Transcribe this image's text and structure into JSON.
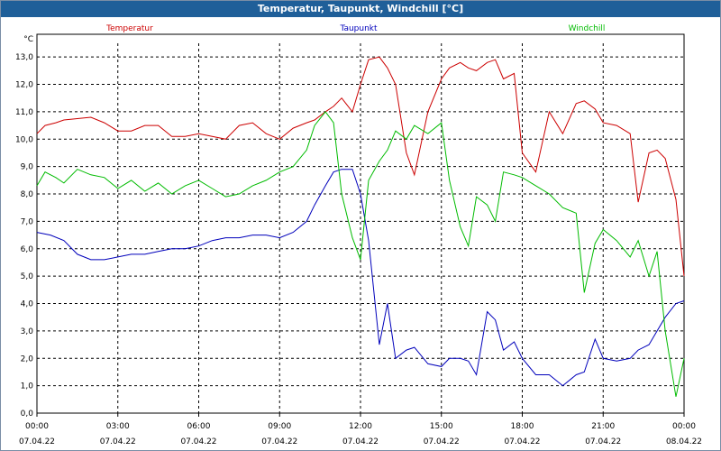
{
  "window": {
    "title": "Temperatur, Taupunkt, Windchill [°C]"
  },
  "colors": {
    "temperatur": "#cc0000",
    "taupunkt": "#0000bb",
    "windchill": "#00bb00",
    "titlebar": "#1f5f99",
    "grid": "#000000"
  },
  "chart_data": {
    "type": "line",
    "title": "Temperatur, Taupunkt, Windchill [°C]",
    "ylabel": "°C",
    "ylim": [
      0,
      13.5
    ],
    "yticks": [
      "0,0",
      "1,0",
      "2,0",
      "3,0",
      "4,0",
      "5,0",
      "6,0",
      "7,0",
      "8,0",
      "9,0",
      "10,0",
      "11,0",
      "12,0",
      "13,0"
    ],
    "xlim": [
      0,
      24
    ],
    "xticks": [
      {
        "time": "00:00",
        "date": "07.04.22"
      },
      {
        "time": "03:00",
        "date": "07.04.22"
      },
      {
        "time": "06:00",
        "date": "07.04.22"
      },
      {
        "time": "09:00",
        "date": "07.04.22"
      },
      {
        "time": "12:00",
        "date": "07.04.22"
      },
      {
        "time": "15:00",
        "date": "07.04.22"
      },
      {
        "time": "18:00",
        "date": "07.04.22"
      },
      {
        "time": "21:00",
        "date": "07.04.22"
      },
      {
        "time": "00:00",
        "date": "08.04.22"
      }
    ],
    "grid": true,
    "legend_position": "top",
    "series": [
      {
        "name": "Temperatur",
        "color": "#cc0000",
        "x": [
          0,
          0.3,
          0.7,
          1,
          1.5,
          2,
          2.5,
          3,
          3.5,
          4,
          4.5,
          5,
          5.5,
          6,
          6.5,
          7,
          7.5,
          8,
          8.5,
          9,
          9.5,
          10,
          10.3,
          10.7,
          11,
          11.3,
          11.7,
          12,
          12.3,
          12.7,
          13,
          13.3,
          13.7,
          14,
          14.5,
          15,
          15.3,
          15.7,
          16,
          16.3,
          16.7,
          17,
          17.3,
          17.7,
          18,
          18.5,
          19,
          19.5,
          20,
          20.3,
          20.7,
          21,
          21.5,
          22,
          22.3,
          22.7,
          23,
          23.3,
          23.7,
          24
        ],
        "y": [
          10.2,
          10.5,
          10.6,
          10.7,
          10.75,
          10.8,
          10.6,
          10.3,
          10.3,
          10.5,
          10.5,
          10.1,
          10.1,
          10.2,
          10.1,
          10.0,
          10.5,
          10.6,
          10.2,
          10.0,
          10.4,
          10.6,
          10.7,
          11.0,
          11.2,
          11.5,
          11.0,
          12.0,
          12.9,
          13.0,
          12.6,
          12.0,
          9.5,
          8.7,
          11.0,
          12.2,
          12.6,
          12.8,
          12.6,
          12.5,
          12.8,
          12.9,
          12.2,
          12.4,
          9.5,
          8.8,
          11.0,
          10.2,
          11.3,
          11.4,
          11.1,
          10.6,
          10.5,
          10.2,
          7.7,
          9.5,
          9.6,
          9.3,
          7.8,
          5.0
        ],
        "xpts": [
          0,
          0.3,
          0.7,
          1,
          1.5,
          2,
          2.5,
          3,
          3.5,
          4,
          4.5,
          5,
          5.5,
          6,
          6.5,
          7,
          7.5,
          8,
          8.5,
          9,
          9.5,
          10,
          10.3,
          10.7,
          11,
          11.3,
          11.7,
          12,
          12.3,
          12.7,
          13,
          13.3,
          13.7,
          14,
          14.5,
          15,
          15.3,
          15.7,
          16,
          16.3,
          16.7,
          17,
          17.3,
          17.7,
          18,
          18.5,
          19,
          19.5,
          20,
          20.3,
          20.7,
          21,
          21.5,
          22,
          22.3,
          22.7,
          23,
          23.3,
          23.7,
          24
        ]
      },
      {
        "name": "Taupunkt",
        "color": "#0000bb",
        "x": [
          0,
          0.5,
          1,
          1.5,
          2,
          2.5,
          3,
          3.5,
          4,
          4.5,
          5,
          5.5,
          6,
          6.5,
          7,
          7.5,
          8,
          8.5,
          9,
          9.5,
          10,
          10.3,
          10.7,
          11,
          11.3,
          11.7,
          12,
          12.3,
          12.7,
          13,
          13.3,
          13.7,
          14,
          14.5,
          15,
          15.3,
          15.7,
          16,
          16.3,
          16.7,
          17,
          17.3,
          17.7,
          18,
          18.5,
          19,
          19.5,
          20,
          20.3,
          20.7,
          21,
          21.5,
          22,
          22.3,
          22.7,
          23,
          23.3,
          23.7,
          24
        ],
        "y": [
          6.6,
          6.5,
          6.3,
          5.8,
          5.6,
          5.6,
          5.7,
          5.8,
          5.8,
          5.9,
          6.0,
          6.0,
          6.1,
          6.3,
          6.4,
          6.4,
          6.5,
          6.5,
          6.4,
          6.6,
          7.0,
          7.6,
          8.3,
          8.8,
          8.9,
          8.9,
          8.0,
          6.3,
          2.5,
          4.0,
          2.0,
          2.3,
          2.4,
          1.8,
          1.7,
          2.0,
          2.0,
          1.9,
          1.4,
          3.7,
          3.4,
          2.3,
          2.6,
          2.0,
          1.4,
          1.4,
          1.0,
          1.4,
          1.5,
          2.7,
          2.0,
          1.9,
          2.0,
          2.3,
          2.5,
          3.0,
          3.5,
          4.0,
          4.1
        ],
        "xpts": [
          0,
          0.5,
          1,
          1.5,
          2,
          2.5,
          3,
          3.5,
          4,
          4.5,
          5,
          5.5,
          6,
          6.5,
          7,
          7.5,
          8,
          8.5,
          9,
          9.5,
          10,
          10.3,
          10.7,
          11,
          11.3,
          11.7,
          12,
          12.3,
          12.7,
          13,
          13.3,
          13.7,
          14,
          14.5,
          15,
          15.3,
          15.7,
          16,
          16.3,
          16.7,
          17,
          17.3,
          17.7,
          18,
          18.5,
          19,
          19.5,
          20,
          20.3,
          20.7,
          21,
          21.5,
          22,
          22.3,
          22.7,
          23,
          23.3,
          23.7,
          24
        ]
      },
      {
        "name": "Windchill",
        "color": "#00bb00",
        "x": [
          0,
          0.3,
          0.7,
          1,
          1.5,
          2,
          2.5,
          3,
          3.5,
          4,
          4.5,
          5,
          5.5,
          6,
          6.5,
          7,
          7.5,
          8,
          8.5,
          9,
          9.5,
          10,
          10.3,
          10.7,
          11,
          11.3,
          11.7,
          12,
          12.3,
          12.7,
          13,
          13.3,
          13.7,
          14,
          14.5,
          15,
          15.3,
          15.7,
          16,
          16.3,
          16.7,
          17,
          17.3,
          17.7,
          18,
          18.5,
          19,
          19.5,
          20,
          20.3,
          20.7,
          21,
          21.5,
          22,
          22.3,
          22.7,
          23,
          23.3,
          23.7,
          24
        ],
        "y": [
          8.3,
          8.8,
          8.6,
          8.4,
          8.9,
          8.7,
          8.6,
          8.2,
          8.5,
          8.1,
          8.4,
          8.0,
          8.3,
          8.5,
          8.2,
          7.9,
          8.0,
          8.3,
          8.5,
          8.8,
          9.0,
          9.6,
          10.5,
          11.0,
          10.6,
          8.0,
          6.4,
          5.6,
          8.5,
          9.2,
          9.6,
          10.3,
          10.0,
          10.5,
          10.2,
          10.6,
          8.5,
          6.8,
          6.1,
          7.9,
          7.6,
          7.0,
          8.8,
          8.7,
          8.6,
          8.3,
          8.0,
          7.5,
          7.3,
          4.4,
          6.2,
          6.7,
          6.3,
          5.7,
          6.3,
          5.0,
          5.9,
          3.0,
          0.6,
          2.0
        ],
        "xpts": [
          0,
          0.3,
          0.7,
          1,
          1.5,
          2,
          2.5,
          3,
          3.5,
          4,
          4.5,
          5,
          5.5,
          6,
          6.5,
          7,
          7.5,
          8,
          8.5,
          9,
          9.5,
          10,
          10.3,
          10.7,
          11,
          11.3,
          11.7,
          12,
          12.3,
          12.7,
          13,
          13.3,
          13.7,
          14,
          14.5,
          15,
          15.3,
          15.7,
          16,
          16.3,
          16.7,
          17,
          17.3,
          17.7,
          18,
          18.5,
          19,
          19.5,
          20,
          20.3,
          20.7,
          21,
          21.5,
          22,
          22.3,
          22.7,
          23,
          23.3,
          23.7,
          24
        ]
      }
    ]
  }
}
